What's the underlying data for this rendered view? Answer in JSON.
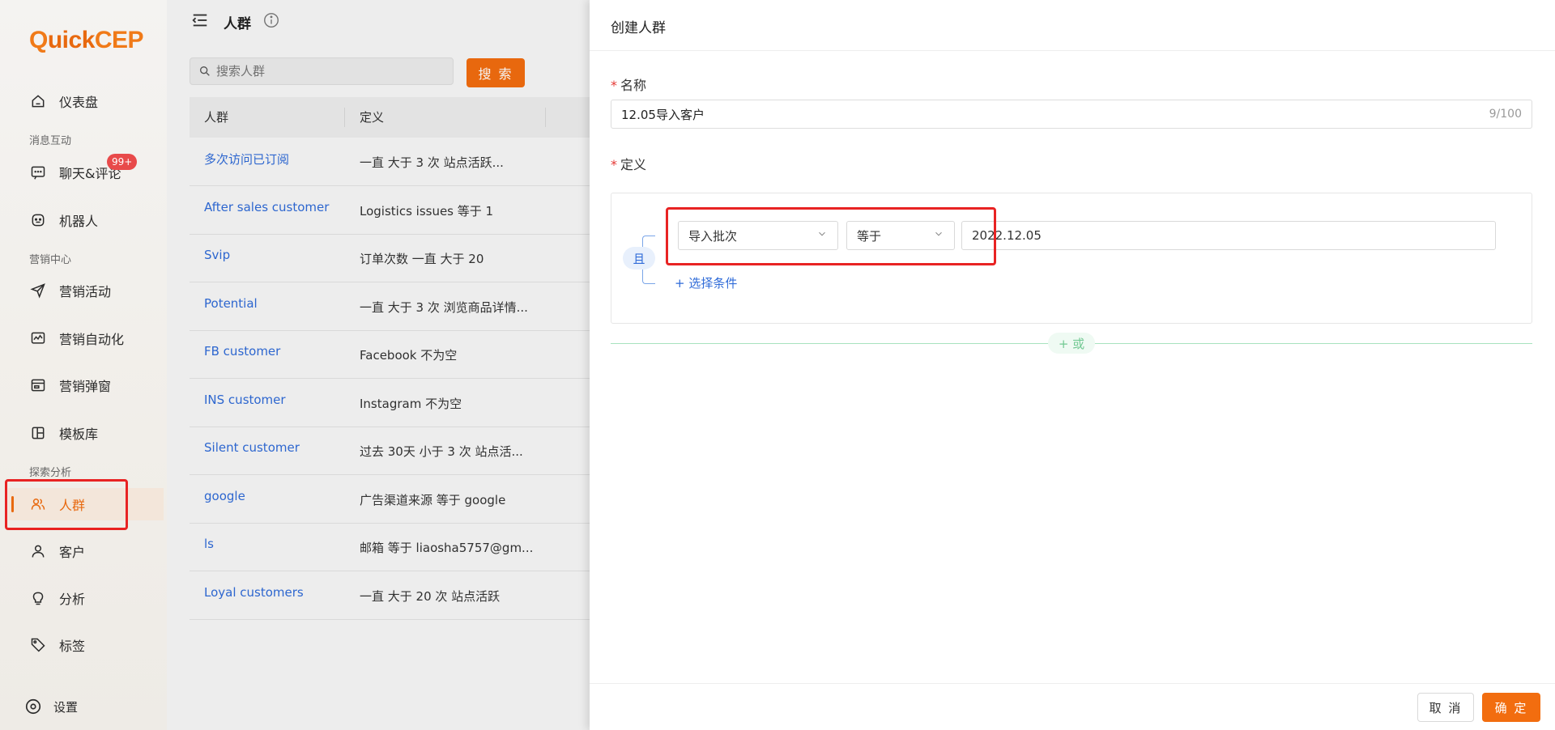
{
  "app": {
    "logo_q": "Q",
    "logo_rest": "uick",
    "logo_cep": "CEP"
  },
  "sidebar": {
    "items": [
      {
        "label": "仪表盘",
        "icon": "home-icon"
      },
      {
        "label": "聊天&评论",
        "icon": "chat-icon",
        "badge": "99+"
      },
      {
        "label": "机器人",
        "icon": "robot-icon"
      },
      {
        "label": "营销活动",
        "icon": "send-icon"
      },
      {
        "label": "营销自动化",
        "icon": "automation-icon"
      },
      {
        "label": "营销弹窗",
        "icon": "popup-icon"
      },
      {
        "label": "模板库",
        "icon": "template-icon"
      },
      {
        "label": "人群",
        "icon": "people-icon",
        "active": true
      },
      {
        "label": "客户",
        "icon": "user-icon"
      },
      {
        "label": "分析",
        "icon": "bulb-icon"
      },
      {
        "label": "标签",
        "icon": "tag-icon"
      }
    ],
    "groups": {
      "msg": "消息互动",
      "mkt": "营销中心",
      "explore": "探索分析"
    },
    "settings": "设置"
  },
  "main": {
    "title": "人群",
    "search_placeholder": "搜索人群",
    "search_button": "搜 索",
    "columns": [
      "人群",
      "定义"
    ],
    "rows": [
      {
        "name": "多次访问已订阅",
        "definition": "一直 大于 3 次 站点活跃..."
      },
      {
        "name": "After sales customer",
        "definition": "Logistics issues 等于 1"
      },
      {
        "name": "Svip",
        "definition": "订单次数 一直 大于 20"
      },
      {
        "name": "Potential",
        "definition": "一直 大于 3 次 浏览商品详情..."
      },
      {
        "name": "FB customer",
        "definition": "Facebook 不为空"
      },
      {
        "name": "INS customer",
        "definition": "Instagram 不为空"
      },
      {
        "name": "Silent customer",
        "definition": "过去 30天 小于 3 次 站点活..."
      },
      {
        "name": "google",
        "definition": "广告渠道来源 等于 google"
      },
      {
        "name": "ls",
        "definition": "邮箱 等于 liaosha5757@gm..."
      },
      {
        "name": "Loyal customers",
        "definition": "一直 大于 20 次 站点活跃"
      }
    ]
  },
  "drawer": {
    "title": "创建人群",
    "name_label": "名称",
    "name_value": "12.05导入客户",
    "name_count": "9/100",
    "definition_label": "定义",
    "and_label": "且",
    "condition": {
      "field": "导入批次",
      "operator": "等于",
      "value": "2022.12.05"
    },
    "add_condition": "+ 选择条件",
    "or_label": "+ 或",
    "cancel": "取 消",
    "confirm": "确 定"
  }
}
